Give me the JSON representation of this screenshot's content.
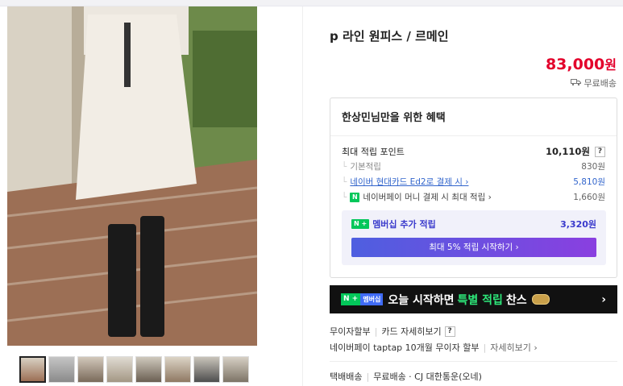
{
  "product": {
    "title": "p 라인 원피스 / 르메인",
    "price": "83,000",
    "currency": "원",
    "shipping_label": "무료배송"
  },
  "benefits": {
    "heading": "한상민님만을 위한 혜택",
    "max_points_label": "최대 적립 포인트",
    "max_points_value": "10,110원",
    "help": "?",
    "items": [
      {
        "label": "기본적립",
        "value": "830원"
      },
      {
        "label": "네이버 현대카드 Ed2로 결제 시 ›",
        "value": "5,810원"
      },
      {
        "label": "네이버페이 머니 결제 시 최대 적립 ›",
        "value": "1,660원"
      }
    ],
    "membership_badge": "N +",
    "membership_label": "멤버십 추가 적립",
    "membership_value": "3,320원",
    "membership_button": "최대 5% 적립 시작하기 ›"
  },
  "banner": {
    "badge_n": "N +",
    "badge_m": "멤버십",
    "text_pre": "오늘 시작하면",
    "text_hl": "특별 적립",
    "text_post": "찬스",
    "arrow": "›"
  },
  "info": {
    "installment": "무이자할부",
    "card_detail": "카드 자세히보기",
    "help": "?",
    "npay_text": "네이버페이 taptap 10개월 무이자 할부",
    "npay_detail": "자세히보기 ›",
    "delivery_label": "택배배송",
    "delivery_value": "무료배송 · CJ 대한통운(오네)"
  },
  "thumbnails": 8,
  "colors": {
    "accent": "#e3002b",
    "naver_green": "#03c75a",
    "link": "#3265cc"
  }
}
